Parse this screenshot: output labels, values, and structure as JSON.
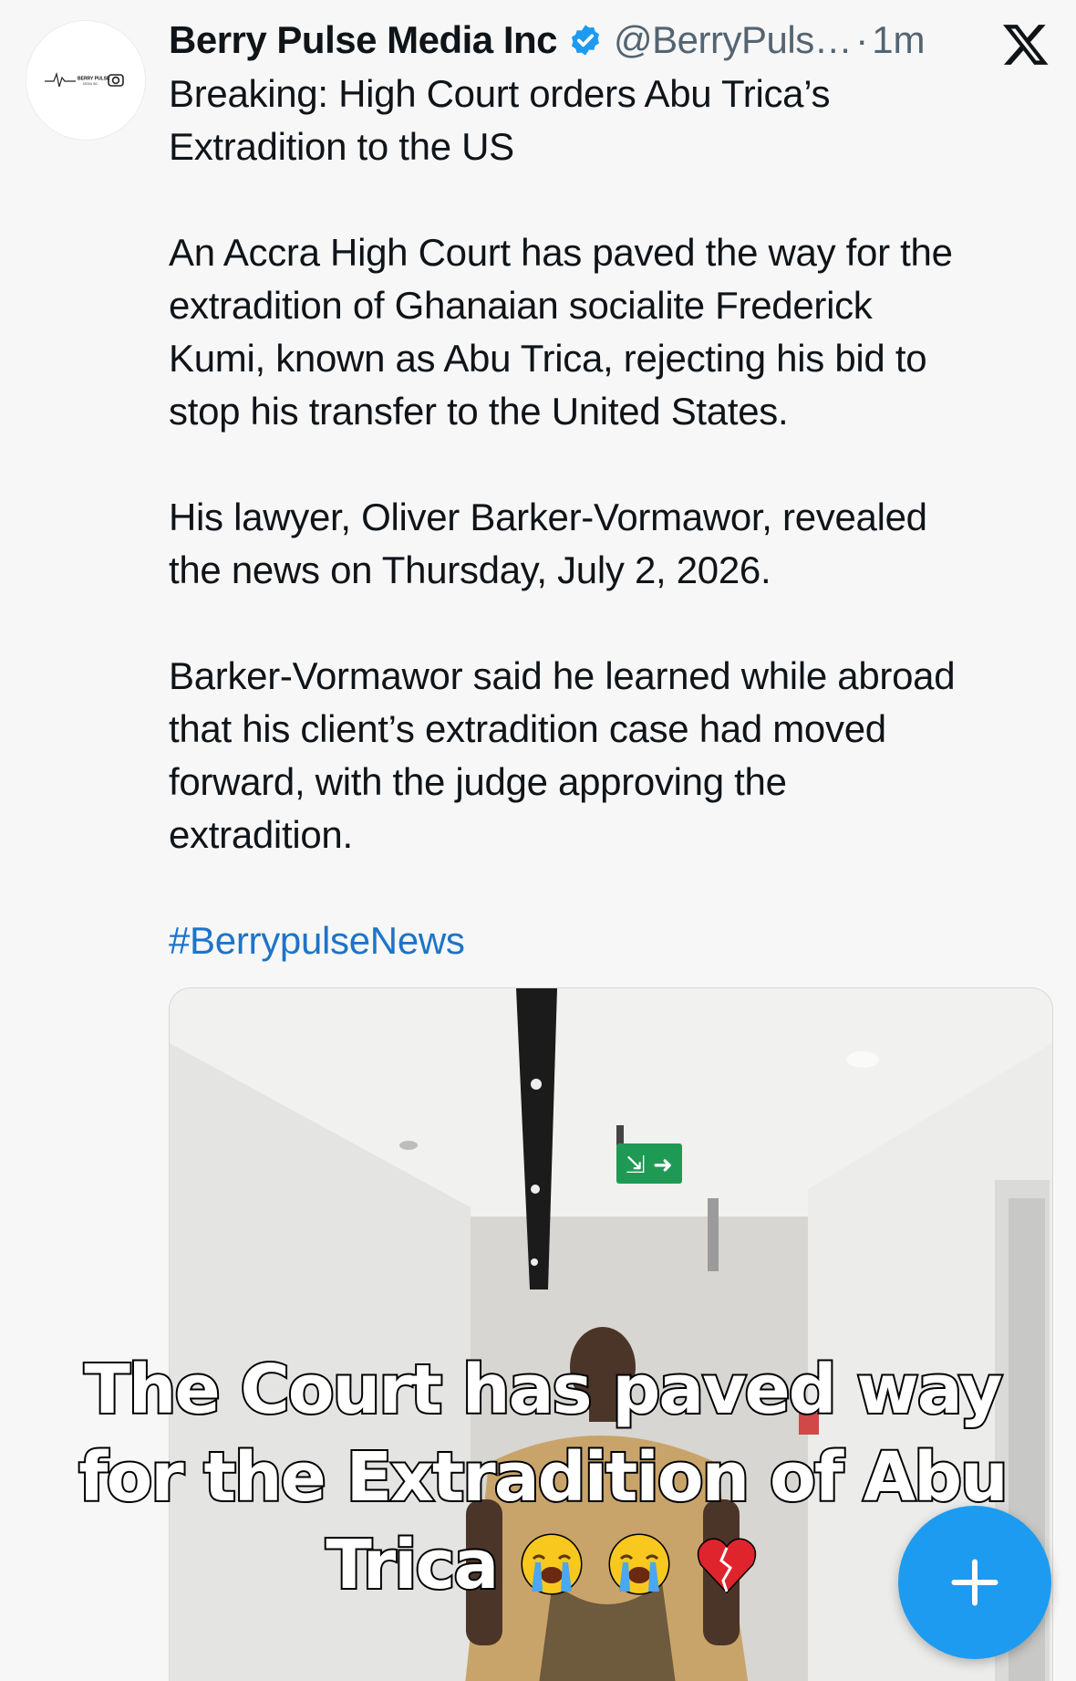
{
  "post": {
    "author": {
      "display_name": "Berry Pulse Media Inc",
      "handle": "@BerryPuls…",
      "verified": true,
      "avatar_text": "BERRY PULSE",
      "avatar_subtext": "MEDIA INC"
    },
    "separator": "·",
    "time": "1m",
    "platform_icon": "x-logo-icon",
    "paragraphs": [
      "Breaking: High Court orders Abu Trica’s\nExtradition to the US",
      "An Accra High Court has paved the way for the\nextradition of Ghanaian socialite Frederick\nKumi, known as Abu Trica, rejecting his bid to\nstop his transfer to the United States.",
      "His lawyer, Oliver Barker-Vormawor, revealed\nthe news on Thursday, July 2, 2026.",
      "Barker-Vormawor said he learned while abroad\nthat his client’s extradition case had moved\nforward, with the judge approving the\nextradition."
    ],
    "hashtag": "#BerrypulseNews",
    "media": {
      "caption_line1": "The Court has paved way",
      "caption_line2": "for the Extradition of Abu",
      "caption_line3": "Trica",
      "caption_emojis": [
        "loudly-crying-face",
        "loudly-crying-face",
        "broken-heart"
      ],
      "exit_sign_icon": "emergency-exit-icon"
    }
  },
  "compose_button": {
    "icon": "plus-icon"
  },
  "colors": {
    "verified_badge": "#1d9bf0",
    "hashtag": "#1d74c8",
    "fab": "#1d9bf0",
    "secondary_text": "#536471",
    "exit_sign": "#1f9a55"
  }
}
